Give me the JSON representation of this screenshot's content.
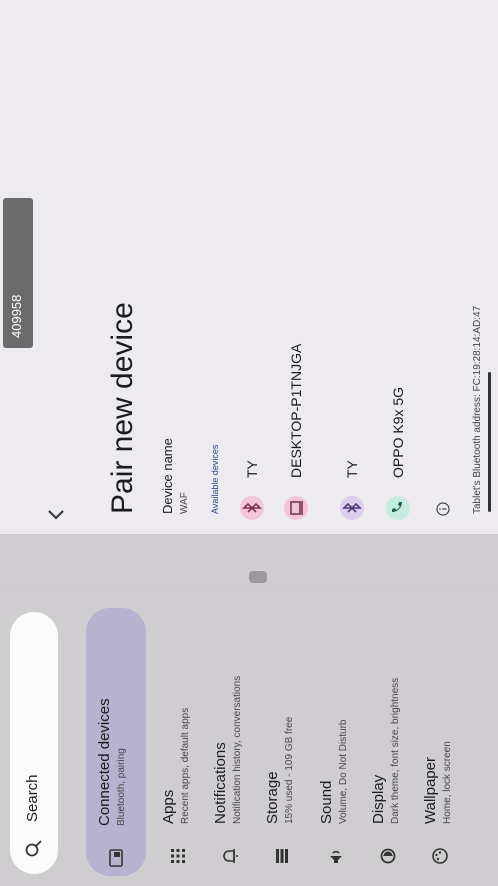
{
  "left": {
    "search_label": "Search",
    "items": [
      {
        "title": "Connected devices",
        "subtitle": "Bluetooth, pairing",
        "icon": "devices-icon",
        "selected": true
      },
      {
        "title": "Apps",
        "subtitle": "Recent apps, default apps",
        "icon": "apps-grid-icon"
      },
      {
        "title": "Notifications",
        "subtitle": "Notification history, conversations",
        "icon": "bell-icon"
      },
      {
        "title": "Storage",
        "subtitle": "15% used - 109 GB free",
        "icon": "storage-icon"
      },
      {
        "title": "Sound",
        "subtitle": "Volume, Do Not Disturb",
        "icon": "sound-icon"
      },
      {
        "title": "Display",
        "subtitle": "Dark theme, font size, brightness",
        "icon": "display-icon"
      },
      {
        "title": "Wallpaper",
        "subtitle": "Home, lock screen",
        "icon": "wallpaper-icon"
      }
    ]
  },
  "status": {
    "text": "409958"
  },
  "right": {
    "title": "Pair new device",
    "device_name_label": "Device name",
    "device_name_value": "WAF",
    "available_label": "Available devices",
    "devices": [
      {
        "name": "TY",
        "icon": "bluetooth-icon",
        "bg": "#f2c6d8"
      },
      {
        "name": "DESKTOP-P1TNJGA",
        "icon": "computer-icon",
        "bg": "#f2c6d8"
      },
      {
        "name": "TY",
        "icon": "bluetooth-icon",
        "bg": "#dcd0ee"
      },
      {
        "name": "OPPO K9x 5G",
        "icon": "phone-icon",
        "bg": "#c6ecdf"
      }
    ],
    "address": "Tablet's Bluetooth address: FC:19:28:14:AD:47"
  }
}
